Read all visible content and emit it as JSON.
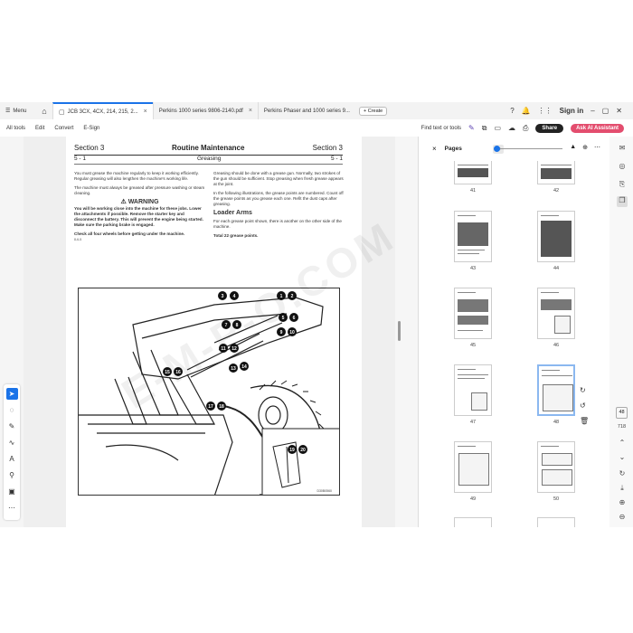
{
  "tabs": {
    "menu_label": "Menu",
    "items": [
      {
        "label": "JCB 3CX, 4CX, 214, 215, 2...",
        "active": true
      },
      {
        "label": "Perkins 1000 series 9806-2140.pdf",
        "active": false
      },
      {
        "label": "Perkins Phaser and 1000 series 9...",
        "active": false
      }
    ],
    "create_label": "+ Create",
    "sign_in_label": "Sign in"
  },
  "toolbar": {
    "all_tools_label": "All tools",
    "edit_label": "Edit",
    "convert_label": "Convert",
    "esign_label": "E-Sign",
    "find_label": "Find text or tools",
    "share_label": "Share",
    "ai_label": "Ask AI Assistant"
  },
  "document": {
    "section_left": "Section 3",
    "title": "Routine Maintenance",
    "section_right": "Section 3",
    "sub_left": "5 - 1",
    "sub_center": "Greasing",
    "sub_right": "5 - 1",
    "col1": {
      "p1": "You must grease the machine regularly to keep it working efficiently. Regular greasing will also lengthen the machine's working life.",
      "p2": "The machine must always be greased after pressure washing or steam cleaning.",
      "warning_title": "⚠ WARNING",
      "warning_body": "You will be working close into the machine for these jobs. Lower the attachments if possible. Remove the starter key and disconnect the battery. This will prevent the engine being started. Make sure the parking brake is engaged.",
      "check": "Check all four wheels before getting under the machine.",
      "code": "8-6-5"
    },
    "col2": {
      "p1": "Greasing should be done with a grease gun. Normally, two strokes of the gun should be sufficient. Stop greasing when fresh grease appears at the joint.",
      "p2": "In the following illustrations, the grease points are numbered. Count off the grease points as you grease each one. Refit the dust caps after greasing.",
      "heading": "Loader Arms",
      "p3": "For each grease point shown, there is another on the other side of the machine.",
      "total": "Total 22 grease points."
    },
    "figure_code": "D30B0560",
    "callouts": [
      "1",
      "2",
      "3",
      "4",
      "5",
      "6",
      "7",
      "8",
      "9",
      "10",
      "11",
      "12",
      "13",
      "14",
      "15",
      "16",
      "17",
      "18",
      "19",
      "20"
    ],
    "watermark": "E-M-P-O.COM"
  },
  "pages_panel": {
    "title": "Pages",
    "thumbnails": [
      {
        "num": "41"
      },
      {
        "num": "42"
      },
      {
        "num": "43"
      },
      {
        "num": "44"
      },
      {
        "num": "45"
      },
      {
        "num": "46"
      },
      {
        "num": "47"
      },
      {
        "num": "48"
      },
      {
        "num": "49"
      },
      {
        "num": "50"
      }
    ],
    "selected_page": "48"
  },
  "right_rail": {
    "current_page": "48",
    "total_pages": "718"
  }
}
